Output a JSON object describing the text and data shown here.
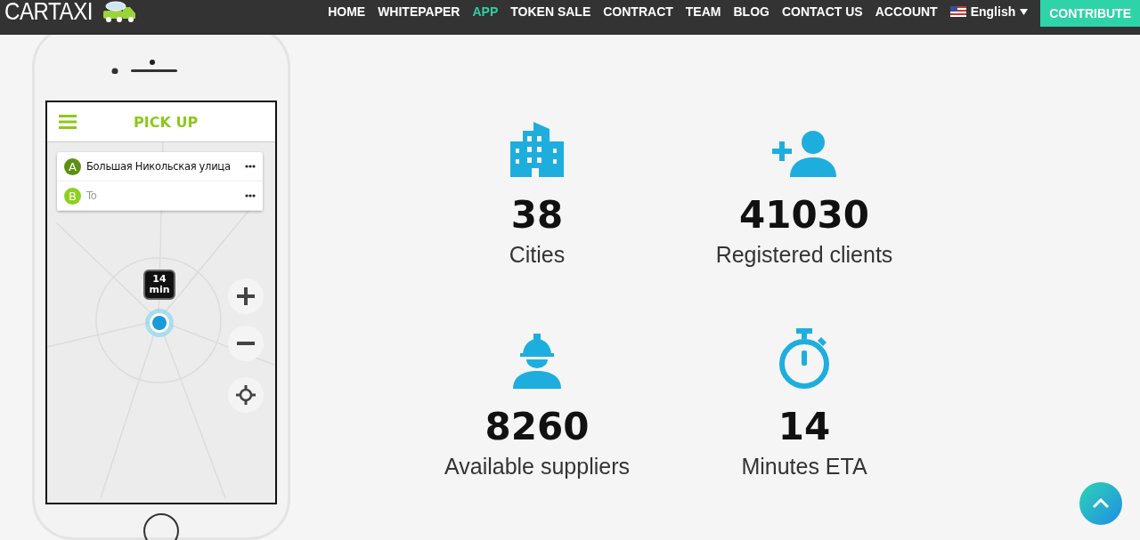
{
  "nav": {
    "logo": "CARTAXI",
    "items": [
      {
        "label": "HOME",
        "selected": false
      },
      {
        "label": "WHITEPAPER",
        "selected": false
      },
      {
        "label": "APP",
        "selected": true
      },
      {
        "label": "TOKEN SALE",
        "selected": false
      },
      {
        "label": "CONTRACT",
        "selected": false
      },
      {
        "label": "TEAM",
        "selected": false
      },
      {
        "label": "BLOG",
        "selected": false
      },
      {
        "label": "CONTACT US",
        "selected": false
      },
      {
        "label": "ACCOUNT",
        "selected": false
      }
    ],
    "language": "English",
    "contribute": "CONTRIBUTE"
  },
  "phone": {
    "app_title": "PICK UP",
    "route": [
      {
        "marker": "A",
        "text": "Большая Никольская улица",
        "filled": true
      },
      {
        "marker": "B",
        "text": "To",
        "filled": false
      }
    ],
    "eta": {
      "value": "14",
      "unit": "min"
    }
  },
  "stats": [
    {
      "kind": "building",
      "value": "38",
      "label": "Cities"
    },
    {
      "kind": "user-plus",
      "value": "41030",
      "label": "Registered clients"
    },
    {
      "kind": "worker",
      "value": "8260",
      "label": "Available suppliers"
    },
    {
      "kind": "stopwatch",
      "value": "14",
      "label": "Minutes ETA"
    }
  ]
}
